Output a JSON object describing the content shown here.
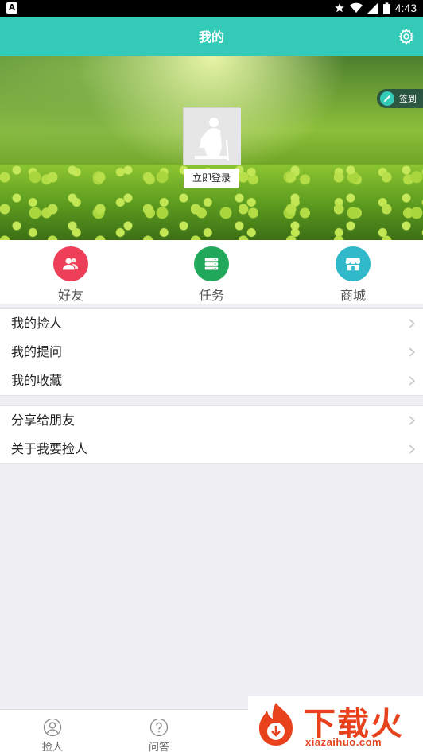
{
  "status_bar": {
    "time": "4:43",
    "notification_letter": "A"
  },
  "header": {
    "title": "我的"
  },
  "banner": {
    "signin_label": "签到",
    "login_label": "立即登录"
  },
  "quick_actions": [
    {
      "label": "好友",
      "color": "#ee3f58",
      "icon": "friends-icon"
    },
    {
      "label": "任务",
      "color": "#22a85a",
      "icon": "task-icon"
    },
    {
      "label": "商城",
      "color": "#2fb9c9",
      "icon": "store-icon"
    }
  ],
  "list_group_1": [
    {
      "label": "我的捡人"
    },
    {
      "label": "我的提问"
    },
    {
      "label": "我的收藏"
    }
  ],
  "list_group_2": [
    {
      "label": "分享给朋友"
    },
    {
      "label": "关于我要捡人"
    }
  ],
  "bottom_nav": [
    {
      "label": "捡人",
      "icon": "person-icon"
    },
    {
      "label": "问答",
      "icon": "question-icon"
    }
  ],
  "watermark": {
    "title": "下载火",
    "url": "xiazaihuo.com"
  },
  "colors": {
    "accent": "#33cbb8"
  }
}
